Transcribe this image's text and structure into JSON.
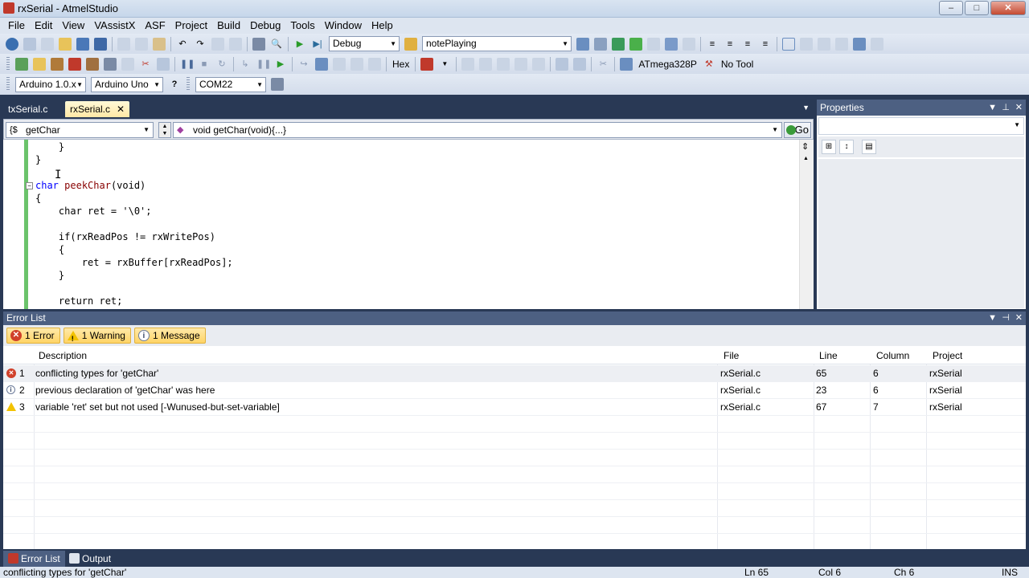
{
  "window": {
    "title": "rxSerial - AtmelStudio",
    "minimize": "–",
    "maximize": "□",
    "close": "✕"
  },
  "menu": [
    "File",
    "Edit",
    "View",
    "VAssistX",
    "ASF",
    "Project",
    "Build",
    "Debug",
    "Tools",
    "Window",
    "Help"
  ],
  "toolbar": {
    "configuration": "Debug",
    "search_combo": "notePlaying",
    "hex_label": "Hex",
    "device": "ATmega328P",
    "tool": "No Tool",
    "arduino_version": "Arduino 1.0.x",
    "board": "Arduino Uno",
    "port": "COM22"
  },
  "doc_tabs": [
    {
      "label": "txSerial.c",
      "active": false
    },
    {
      "label": "rxSerial.c",
      "active": true
    }
  ],
  "navigation": {
    "scope": "getChar",
    "member": "void getChar(void){...}",
    "go_label": "Go"
  },
  "code": [
    "    }",
    "}",
    "",
    "char peekChar(void)",
    "{",
    "    char ret = '\\0';",
    "",
    "    if(rxReadPos != rxWritePos)",
    "    {",
    "        ret = rxBuffer[rxReadPos];",
    "    }",
    "",
    "    return ret;"
  ],
  "properties": {
    "title": "Properties"
  },
  "error_list": {
    "title": "Error List",
    "filters": {
      "errors": "1 Error",
      "warnings": "1 Warning",
      "messages": "1 Message"
    },
    "columns": [
      "Description",
      "File",
      "Line",
      "Column",
      "Project"
    ],
    "rows": [
      {
        "type": "error",
        "num": "1",
        "description": "conflicting types for 'getChar'",
        "file": "rxSerial.c",
        "line": "65",
        "column": "6",
        "project": "rxSerial"
      },
      {
        "type": "info",
        "num": "2",
        "description": "previous declaration of 'getChar' was here",
        "file": "rxSerial.c",
        "line": "23",
        "column": "6",
        "project": "rxSerial"
      },
      {
        "type": "warning",
        "num": "3",
        "description": "variable 'ret' set but not used [-Wunused-but-set-variable]",
        "file": "rxSerial.c",
        "line": "67",
        "column": "7",
        "project": "rxSerial"
      }
    ]
  },
  "bottom_tabs": [
    "Error List",
    "Output"
  ],
  "status": {
    "message": "conflicting types for 'getChar'",
    "line": "Ln 65",
    "col": "Col 6",
    "ch": "Ch 6",
    "mode": "INS"
  }
}
